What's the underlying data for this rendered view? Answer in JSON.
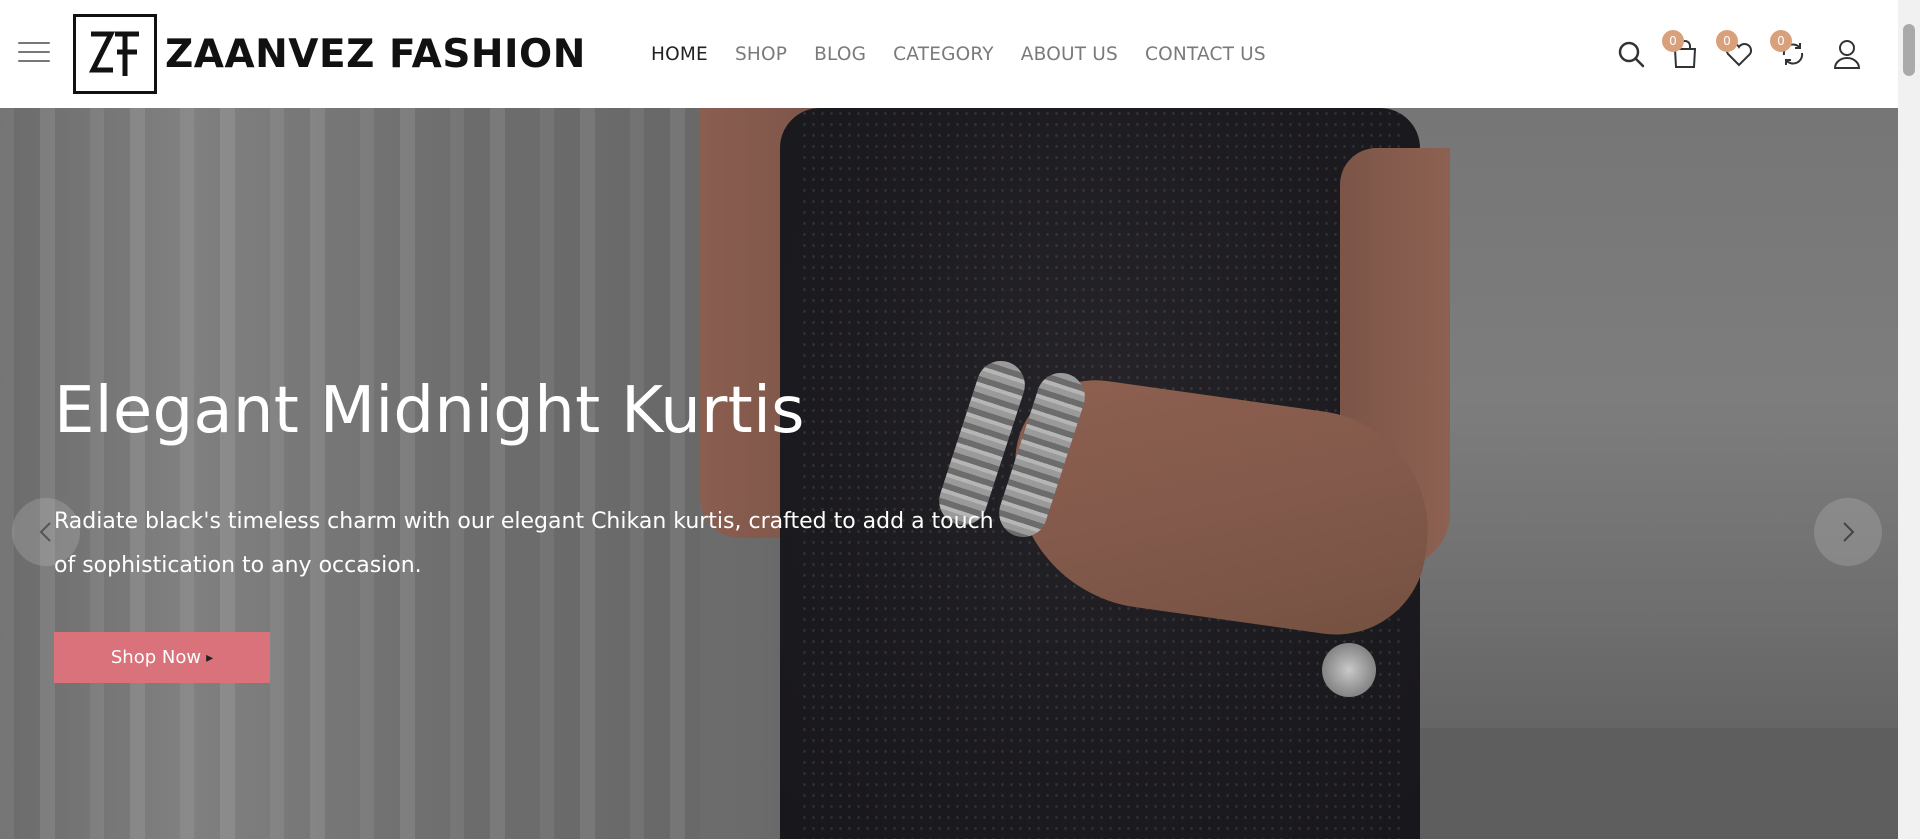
{
  "header": {
    "brand": "ZAANVEZ FASHION",
    "menu_icon": "hamburger-menu-icon",
    "nav": [
      {
        "label": "HOME",
        "active": true
      },
      {
        "label": "SHOP",
        "active": false
      },
      {
        "label": "BLOG",
        "active": false
      },
      {
        "label": "CATEGORY",
        "active": false
      },
      {
        "label": "ABOUT US",
        "active": false
      },
      {
        "label": "CONTACT US",
        "active": false
      }
    ],
    "icons": {
      "search": "search-icon",
      "cart": "shopping-bag-icon",
      "wishlist": "heart-icon",
      "compare": "compare-icon",
      "account": "user-icon"
    },
    "cart_count": "0",
    "wishlist_count": "0",
    "compare_count": "0"
  },
  "hero": {
    "title": "Elegant Midnight Kurtis",
    "description": "Radiate black's timeless charm with our elegant Chikan kurtis, crafted to add a touch of sophistication to any occasion.",
    "button_label": "Shop Now",
    "prev_icon": "chevron-left-icon",
    "next_icon": "chevron-right-icon"
  },
  "colors": {
    "accent": "#d9727a",
    "badge": "#d8a07b",
    "nav_active": "#222222",
    "nav_inactive": "#7a7a7a"
  }
}
